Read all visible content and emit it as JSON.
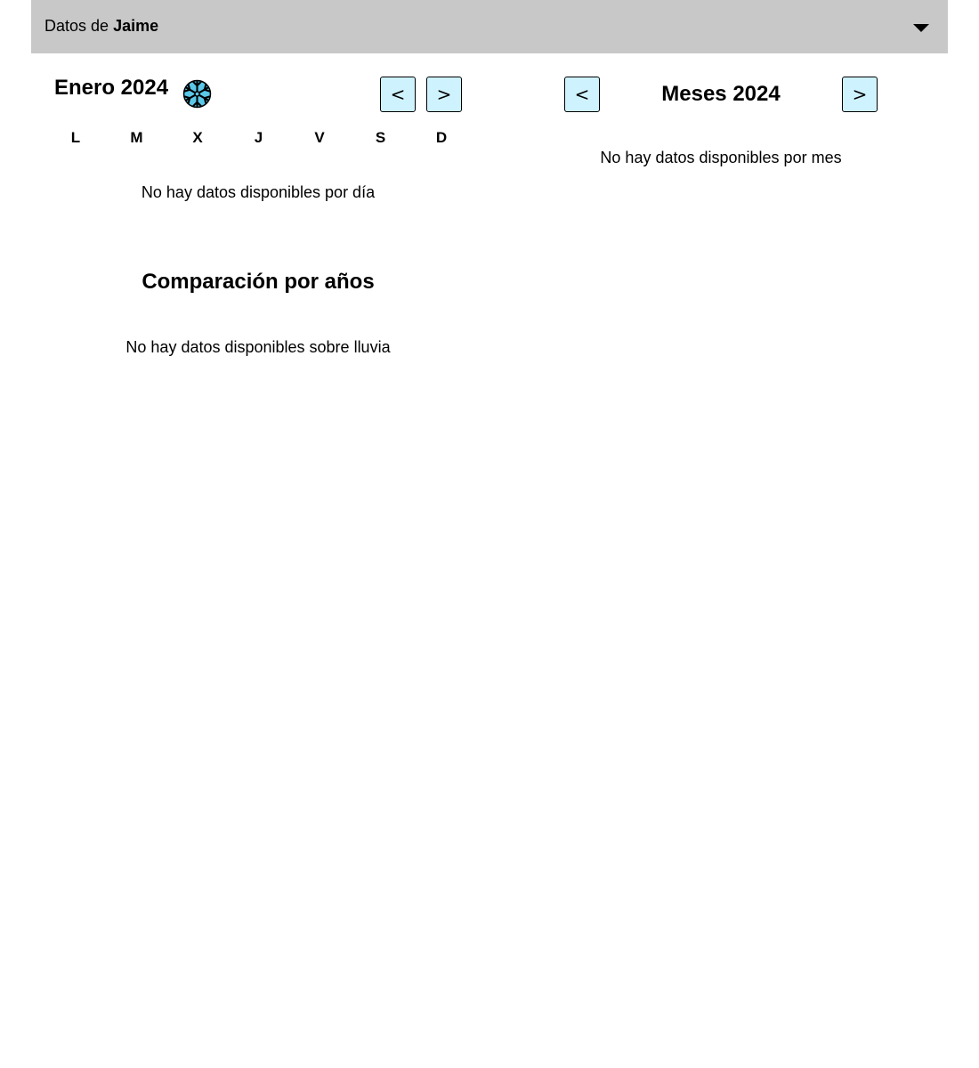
{
  "header": {
    "prefix": "Datos de",
    "user": "Jaime",
    "dropdown_icon": "caret-down-icon"
  },
  "daily": {
    "month_title": "Enero 2024",
    "season_icon": "snowflake-icon",
    "prev_label": "<",
    "next_label": ">",
    "weekdays": [
      "L",
      "M",
      "X",
      "J",
      "V",
      "S",
      "D"
    ],
    "empty_message": "No hay datos disponibles por día"
  },
  "monthly": {
    "title": "Meses 2024",
    "prev_label": "<",
    "next_label": ">",
    "empty_message": "No hay datos disponibles por mes"
  },
  "yearly": {
    "title": "Comparación por años",
    "empty_message": "No hay datos disponibles sobre lluvia"
  },
  "colors": {
    "header_bg": "#c8c8c8",
    "button_bg": "#cff3fe",
    "snowflake": "#5bc8e8"
  }
}
